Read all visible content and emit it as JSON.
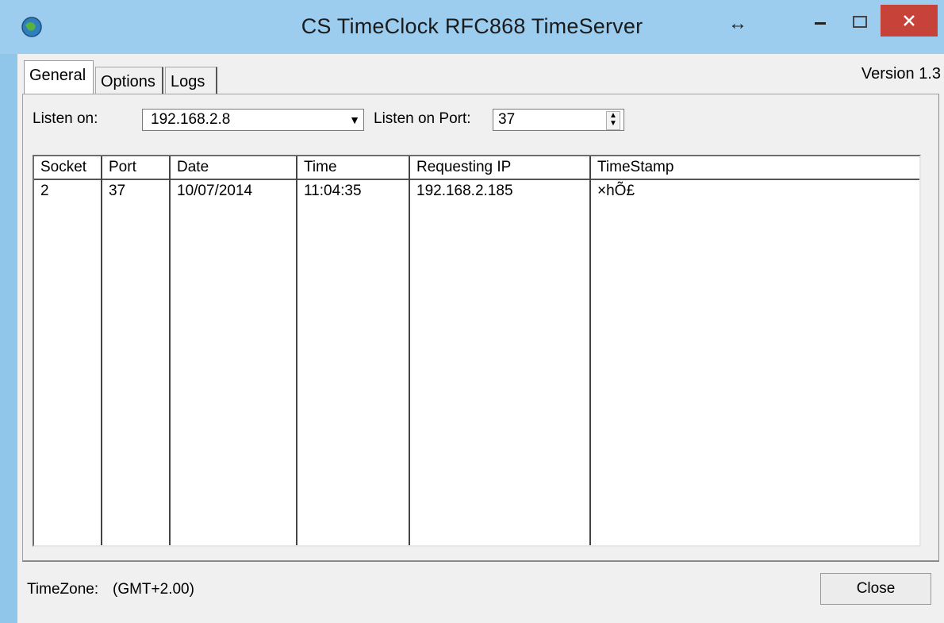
{
  "window": {
    "title": "CS TimeClock RFC868 TimeServer",
    "resize_icon": "↔",
    "minimize_icon": "—",
    "maximize_icon": "☐",
    "close_icon": "✕"
  },
  "tabs": [
    {
      "label": "General"
    },
    {
      "label": "Options"
    },
    {
      "label": "Logs"
    }
  ],
  "version_label": "Version 1.3",
  "listen_on": {
    "label": "Listen on:",
    "value": "192.168.2.8",
    "arrow": "▼"
  },
  "listen_port": {
    "label": "Listen on Port:",
    "value": "37",
    "spin_up": "▲",
    "spin_down": "▼"
  },
  "table": {
    "columns": [
      "Socket",
      "Port",
      "Date",
      "Time",
      "Requesting IP",
      "TimeStamp"
    ],
    "rows": [
      [
        "2",
        "37",
        "10/07/2014",
        "11:04:35",
        "192.168.2.185",
        "×hÕ£"
      ]
    ]
  },
  "footer": {
    "timezone_label": "TimeZone:",
    "timezone_value": "(GMT+2.00)",
    "close_label": "Close"
  },
  "colors": {
    "titlebar": "#9ccdee",
    "close_button": "#c7433a",
    "client": "#f0f0f0"
  }
}
